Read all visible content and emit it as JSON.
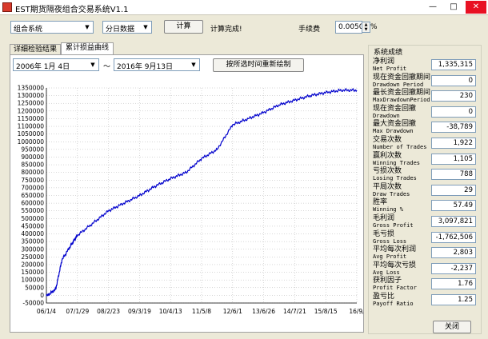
{
  "window": {
    "title": "EST期货隔夜组合交易系统V1.1"
  },
  "toolbar": {
    "system_select": "组合系统",
    "period_select": "分日数据",
    "calc_label": "计算",
    "status": "计算完成!",
    "fee_label": "手续费",
    "fee_value": "0.0050",
    "fee_unit": "%"
  },
  "tabs": [
    {
      "label": "详细检验结果"
    },
    {
      "label": "累计损益曲线"
    }
  ],
  "chart_panel": {
    "start_date": "2006年 1月 4日",
    "date_sep": "～",
    "end_date": "2016年 9月13日",
    "redraw_label": "按所选时间重新绘制"
  },
  "stats": {
    "group_title": "系统成绩",
    "items": [
      {
        "label": "净利润",
        "sub": "Net Profit",
        "value": "1,335,315"
      },
      {
        "label": "现在资金回撤期间",
        "sub": "Drawdown Period",
        "value": "0"
      },
      {
        "label": "最长资金回撤期间",
        "sub": "MaxDrawdownPeriod",
        "value": "230"
      },
      {
        "label": "现在资金回撤",
        "sub": "Drawdown",
        "value": "0"
      },
      {
        "label": "最大资金回撤",
        "sub": "Max Drawdown",
        "value": "-38,789"
      },
      {
        "label": "交易次数",
        "sub": "Number of Trades",
        "value": "1,922"
      },
      {
        "label": "赢利次数",
        "sub": "Winning Trades",
        "value": "1,105"
      },
      {
        "label": "亏损次数",
        "sub": "Losing Trades",
        "value": "788"
      },
      {
        "label": "平局次数",
        "sub": "Draw Trades",
        "value": "29"
      },
      {
        "label": "胜率",
        "sub": "Winning %",
        "value": "57.49"
      },
      {
        "label": "毛利润",
        "sub": "Gross Profit",
        "value": "3,097,821"
      },
      {
        "label": "毛亏损",
        "sub": "Gross Loss",
        "value": "-1,762,506"
      },
      {
        "label": "平均每次利润",
        "sub": "Avg Profit",
        "value": "2,803"
      },
      {
        "label": "平均每次亏损",
        "sub": "Avg Loss",
        "value": "-2,237"
      },
      {
        "label": "获利因子",
        "sub": "Profit Factor",
        "value": "1.76"
      },
      {
        "label": "盈亏比",
        "sub": "Payoff Ratio",
        "value": "1.25"
      }
    ],
    "close_label": "关闭"
  },
  "chart_data": {
    "type": "line",
    "title": "",
    "xlabel": "",
    "ylabel": "",
    "ylim": [
      -50000,
      1350000
    ],
    "y_ticks": [
      -50000,
      0,
      50000,
      100000,
      150000,
      200000,
      250000,
      300000,
      350000,
      400000,
      450000,
      500000,
      550000,
      600000,
      650000,
      700000,
      750000,
      800000,
      850000,
      900000,
      950000,
      1000000,
      1050000,
      1100000,
      1150000,
      1200000,
      1250000,
      1300000,
      1350000
    ],
    "x_ticks": [
      "06/1/4",
      "07/1/29",
      "08/2/23",
      "09/3/19",
      "10/4/13",
      "11/5/8",
      "12/6/1",
      "13/6/26",
      "14/7/21",
      "15/8/15",
      "16/9/"
    ],
    "grid": true,
    "series": [
      {
        "color": "#0000cc",
        "x": [
          0,
          0.3,
          0.5,
          0.8,
          1.0,
          1.5,
          2.0,
          2.5,
          3.0,
          3.5,
          4.0,
          4.5,
          5.0,
          5.5,
          6.0,
          6.5,
          7.0,
          7.5,
          8.0,
          8.5,
          9.0,
          9.5,
          10.0
        ],
        "y": [
          -5000,
          40000,
          230000,
          330000,
          390000,
          470000,
          550000,
          600000,
          650000,
          710000,
          760000,
          800000,
          890000,
          950000,
          1110000,
          1150000,
          1190000,
          1240000,
          1270000,
          1300000,
          1320000,
          1335315,
          1335315
        ]
      }
    ]
  }
}
